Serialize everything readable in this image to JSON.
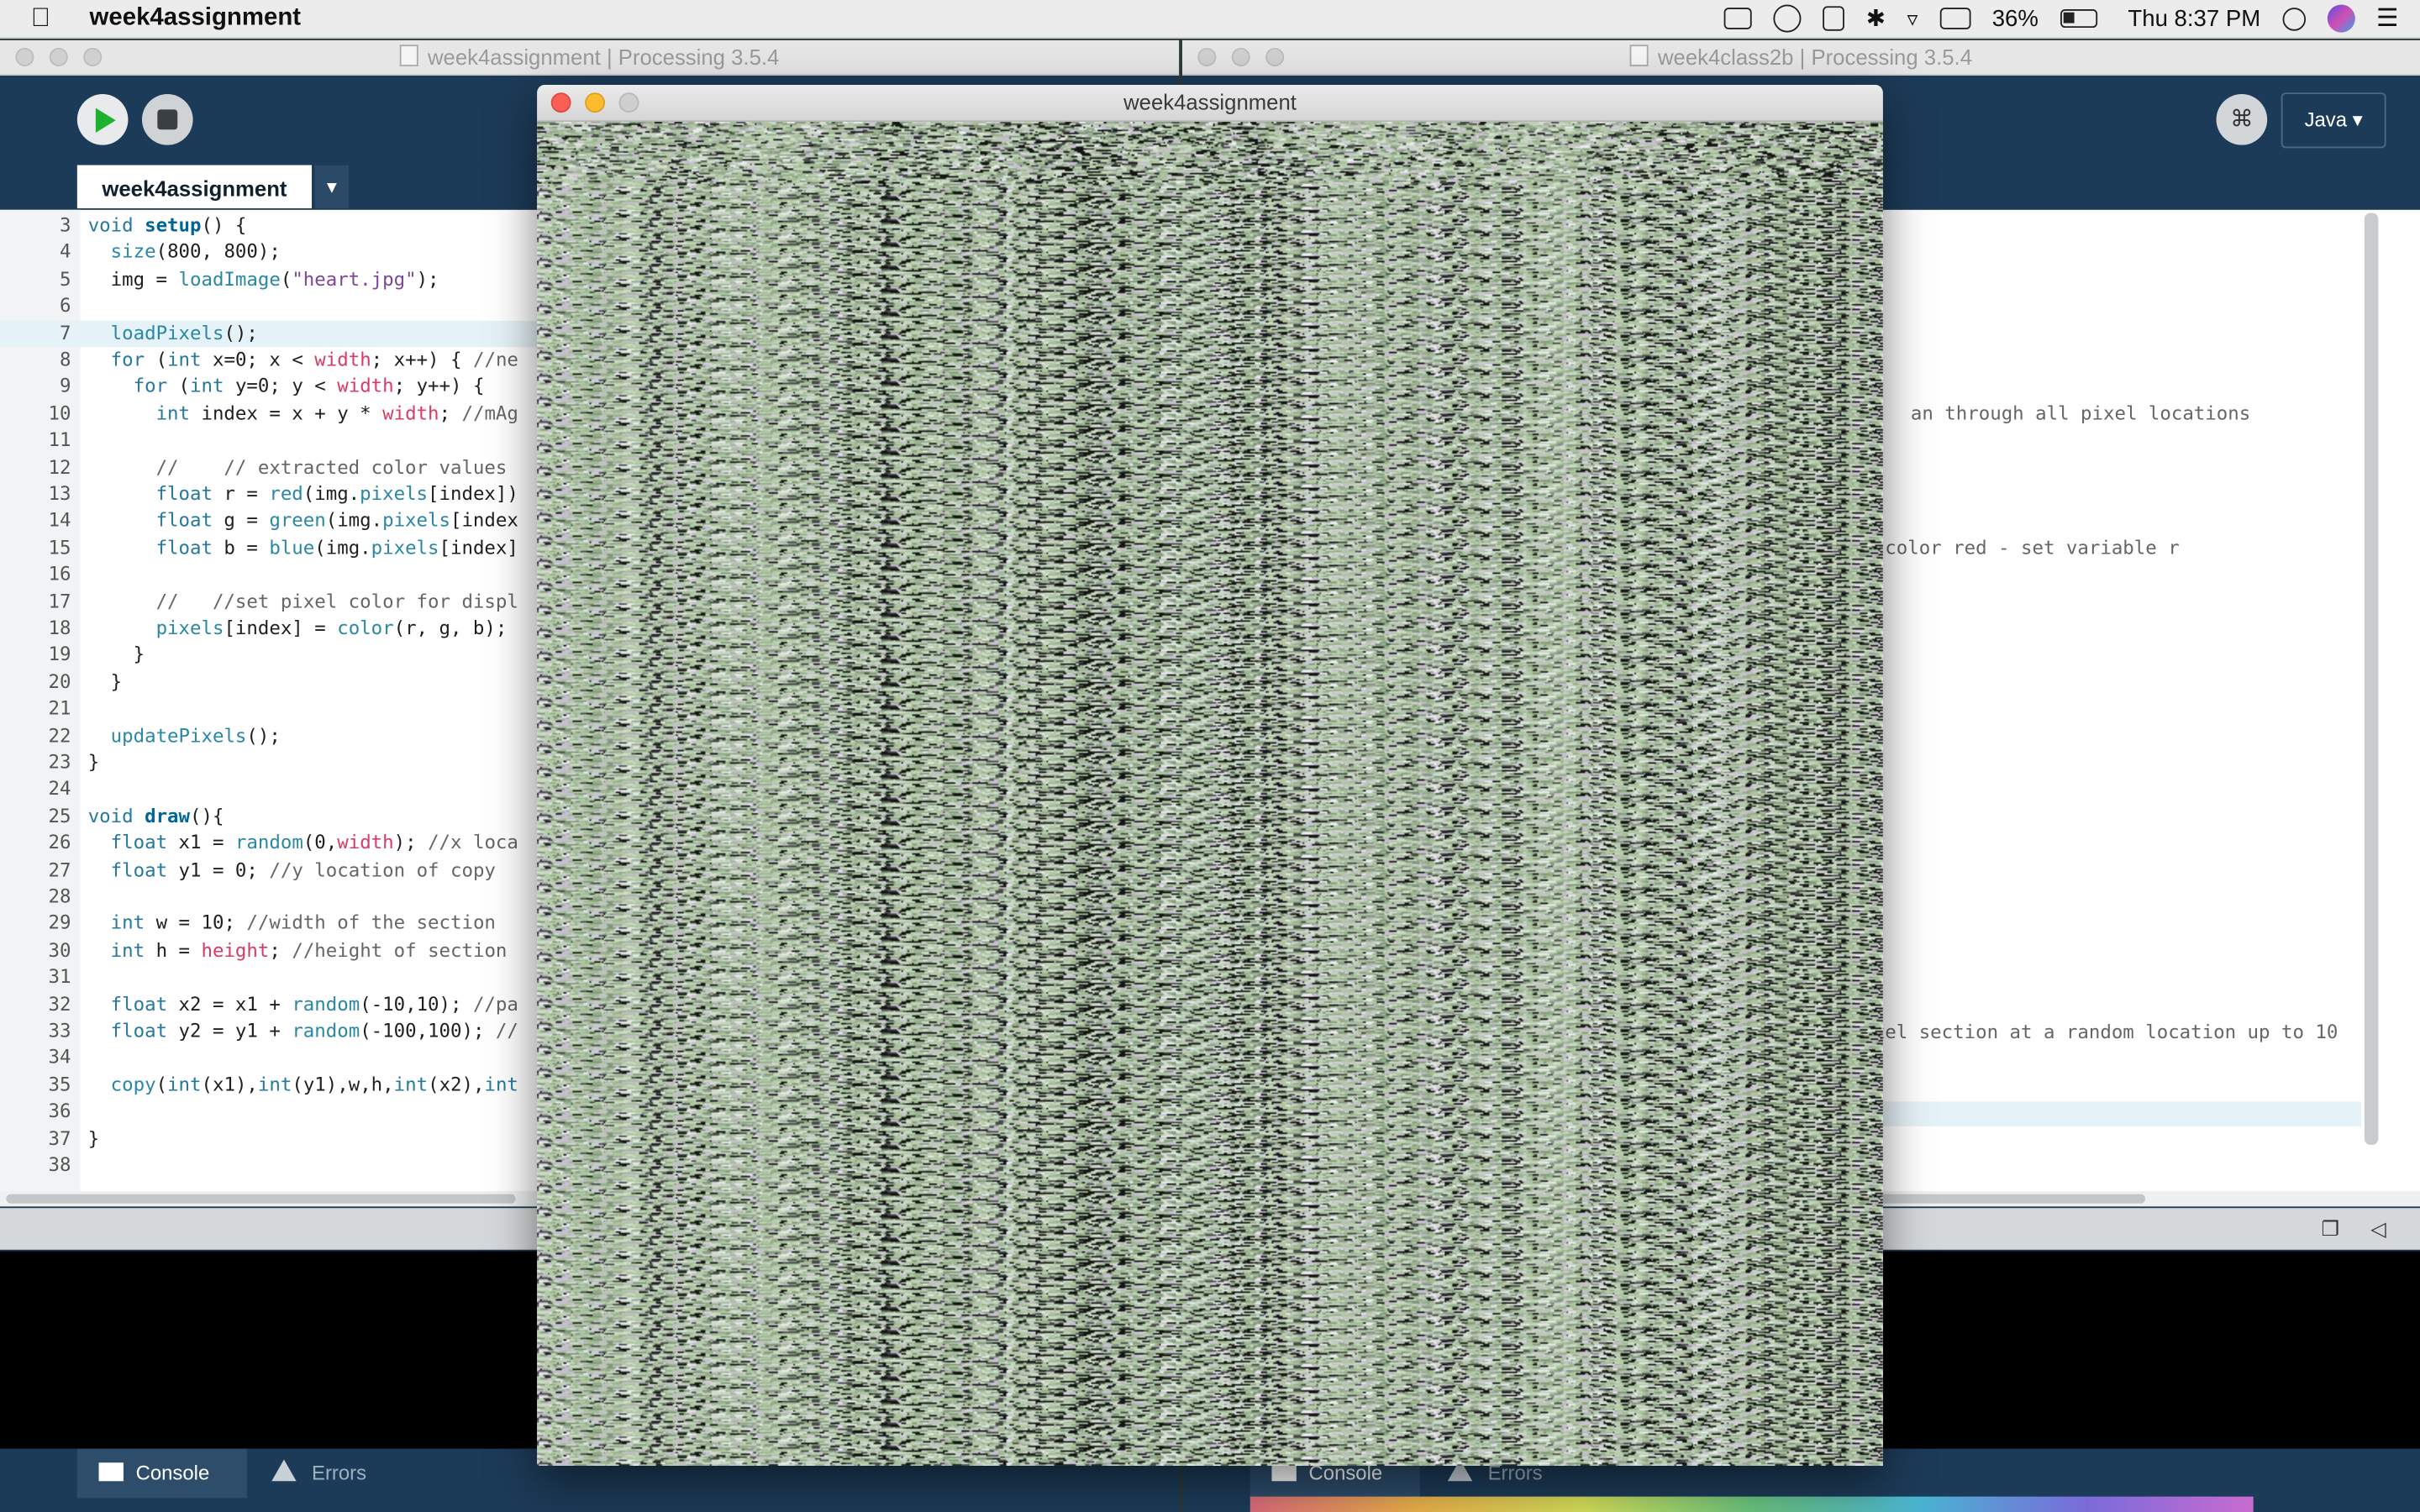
{
  "menubar": {
    "app_name": "week4assignment",
    "battery": "36%",
    "clock": "Thu 8:37 PM"
  },
  "left_window": {
    "title": "week4assignment | Processing 3.5.4",
    "tab_label": "week4assignment",
    "lines": [
      {
        "n": "3",
        "t": "void setup() {"
      },
      {
        "n": "4",
        "t": "  size(800, 800);"
      },
      {
        "n": "5",
        "t": "  img = loadImage(\"heart.jpg\");"
      },
      {
        "n": "6",
        "t": ""
      },
      {
        "n": "7",
        "t": "  loadPixels();"
      },
      {
        "n": "8",
        "t": "  for (int x=0; x < width; x++) { //ne"
      },
      {
        "n": "9",
        "t": "    for (int y=0; y < width; y++) {"
      },
      {
        "n": "10",
        "t": "      int index = x + y * width; //mAg"
      },
      {
        "n": "11",
        "t": ""
      },
      {
        "n": "12",
        "t": "      //    // extracted color values"
      },
      {
        "n": "13",
        "t": "      float r = red(img.pixels[index])"
      },
      {
        "n": "14",
        "t": "      float g = green(img.pixels[index"
      },
      {
        "n": "15",
        "t": "      float b = blue(img.pixels[index]"
      },
      {
        "n": "16",
        "t": ""
      },
      {
        "n": "17",
        "t": "      //   //set pixel color for displ"
      },
      {
        "n": "18",
        "t": "      pixels[index] = color(r, g, b);"
      },
      {
        "n": "19",
        "t": "    }"
      },
      {
        "n": "20",
        "t": "  }"
      },
      {
        "n": "21",
        "t": ""
      },
      {
        "n": "22",
        "t": "  updatePixels();"
      },
      {
        "n": "23",
        "t": "}"
      },
      {
        "n": "24",
        "t": ""
      },
      {
        "n": "25",
        "t": "void draw(){"
      },
      {
        "n": "26",
        "t": "  float x1 = random(0,width); //x loca"
      },
      {
        "n": "27",
        "t": "  float y1 = 0; //y location of copy"
      },
      {
        "n": "28",
        "t": ""
      },
      {
        "n": "29",
        "t": "  int w = 10; //width of the section"
      },
      {
        "n": "30",
        "t": "  int h = height; //height of section"
      },
      {
        "n": "31",
        "t": ""
      },
      {
        "n": "32",
        "t": "  float x2 = x1 + random(-10,10); //pa"
      },
      {
        "n": "33",
        "t": "  float y2 = y1 + random(-100,100); //"
      },
      {
        "n": "34",
        "t": ""
      },
      {
        "n": "35",
        "t": "  copy(int(x1),int(y1),w,h,int(x2),int"
      },
      {
        "n": "36",
        "t": ""
      },
      {
        "n": "37",
        "t": "}"
      },
      {
        "n": "38",
        "t": ""
      }
    ],
    "console_tab": "Console",
    "errors_tab": "Errors"
  },
  "right_window": {
    "title": "week4class2b | Processing 3.5.4",
    "mode_label": "Java ▾",
    "visible_fragments": [
      "an through all pixel locations",
      " color red - set variable r",
      "xel section at a random location up to 10"
    ],
    "console_tab": "Console",
    "errors_tab": "Errors"
  },
  "sketch_window": {
    "title": "week4assignment"
  },
  "colors": {
    "processing_blue": "#1c3b58",
    "run_green": "#1eb02f",
    "close_red": "#fc5f57",
    "minimize_yellow": "#fdbc2e"
  }
}
